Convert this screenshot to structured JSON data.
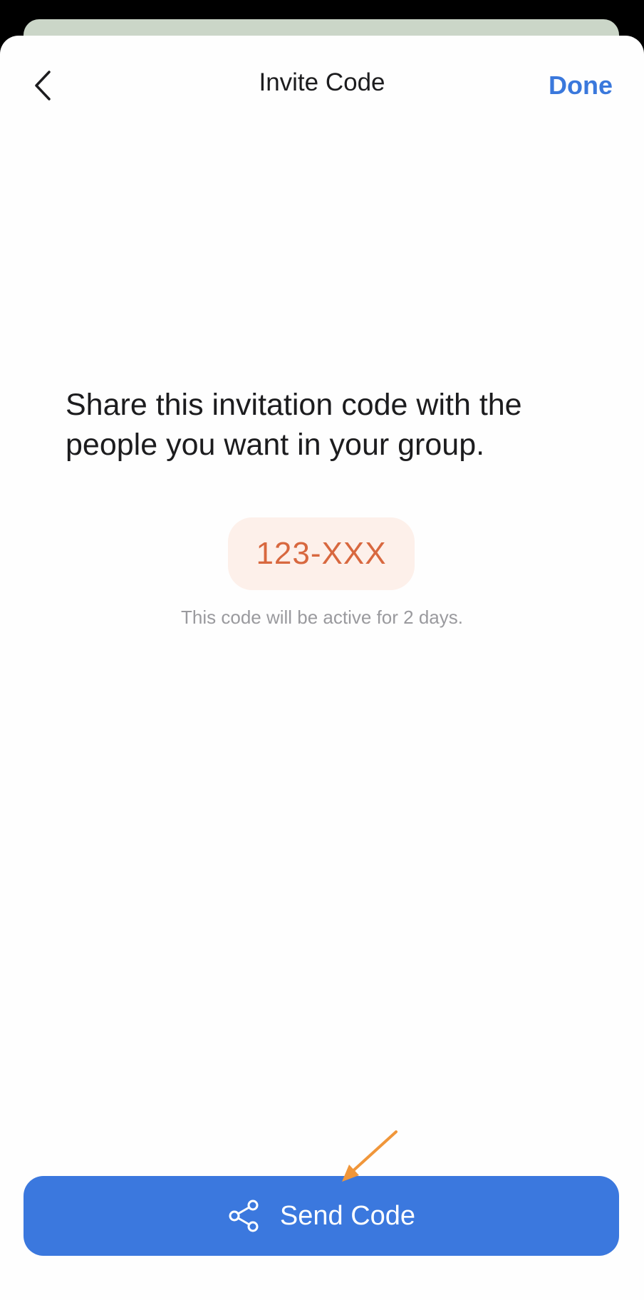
{
  "nav": {
    "title": "Invite Code",
    "done_label": "Done",
    "back_icon": "chevron-left-icon"
  },
  "main": {
    "message": "Share this invitation code with the people you want in your group.",
    "code": "123-XXX",
    "code_note": "This code will be active for 2 days."
  },
  "footer": {
    "send_label": "Send Code",
    "send_icon": "share-icon"
  },
  "colors": {
    "accent": "#3b78de",
    "code_text": "#d8683f",
    "code_bg": "#fdf0ea",
    "annotation_arrow": "#f0963a"
  }
}
